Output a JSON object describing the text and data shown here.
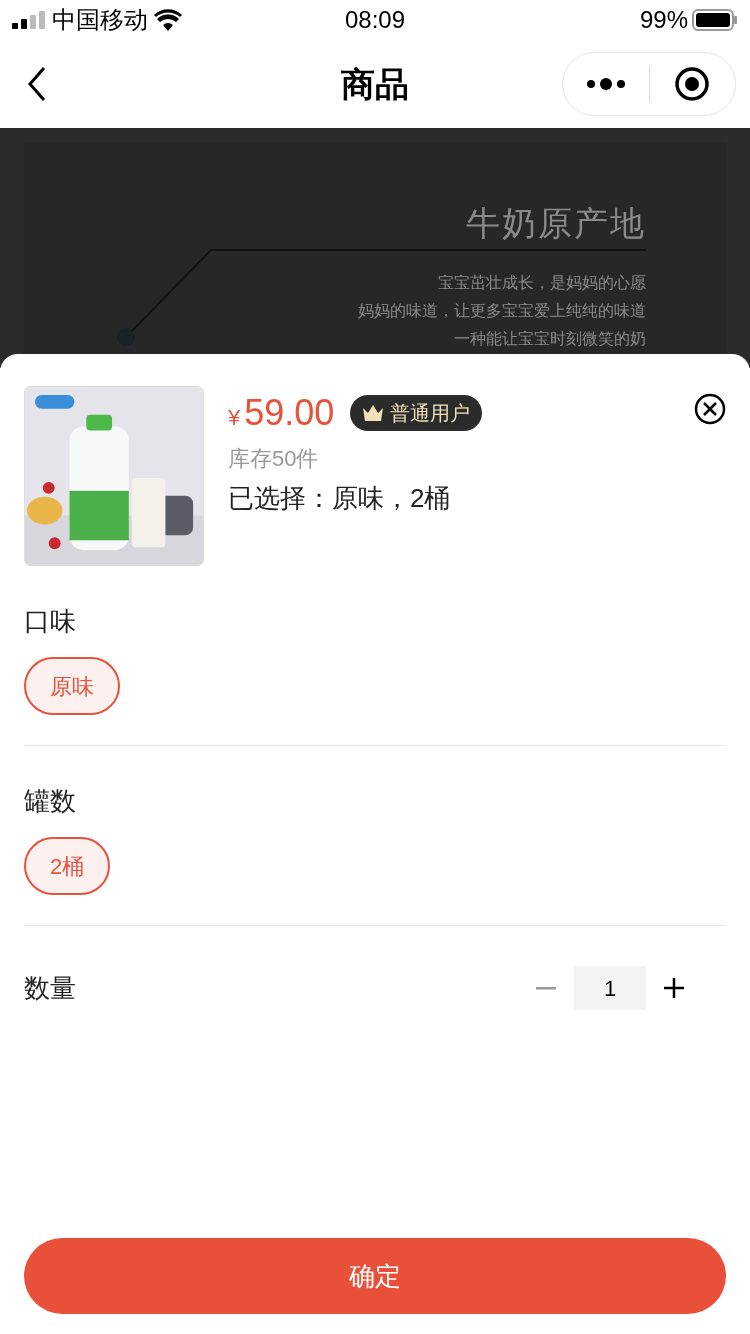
{
  "status_bar": {
    "carrier": "中国移动",
    "time": "08:09",
    "battery": "99%"
  },
  "nav": {
    "title": "商品"
  },
  "banner": {
    "heading": "牛奶原产地",
    "lines": [
      "宝宝茁壮成长，是妈妈的心愿",
      "妈妈的味道，让更多宝宝爱上纯纯的味道",
      "一种能让宝宝时刻微笑的奶"
    ]
  },
  "sheet": {
    "currency": "¥",
    "price": "59.00",
    "member_badge": "普通用户",
    "stock": "库存50件",
    "selection": "已选择：原味，2桶",
    "groups": [
      {
        "label": "口味",
        "options": [
          {
            "label": "原味",
            "selected": true
          }
        ]
      },
      {
        "label": "罐数",
        "options": [
          {
            "label": "2桶",
            "selected": true
          }
        ]
      }
    ],
    "quantity": {
      "label": "数量",
      "value": "1",
      "minus_disabled": true
    },
    "confirm": "确定"
  }
}
